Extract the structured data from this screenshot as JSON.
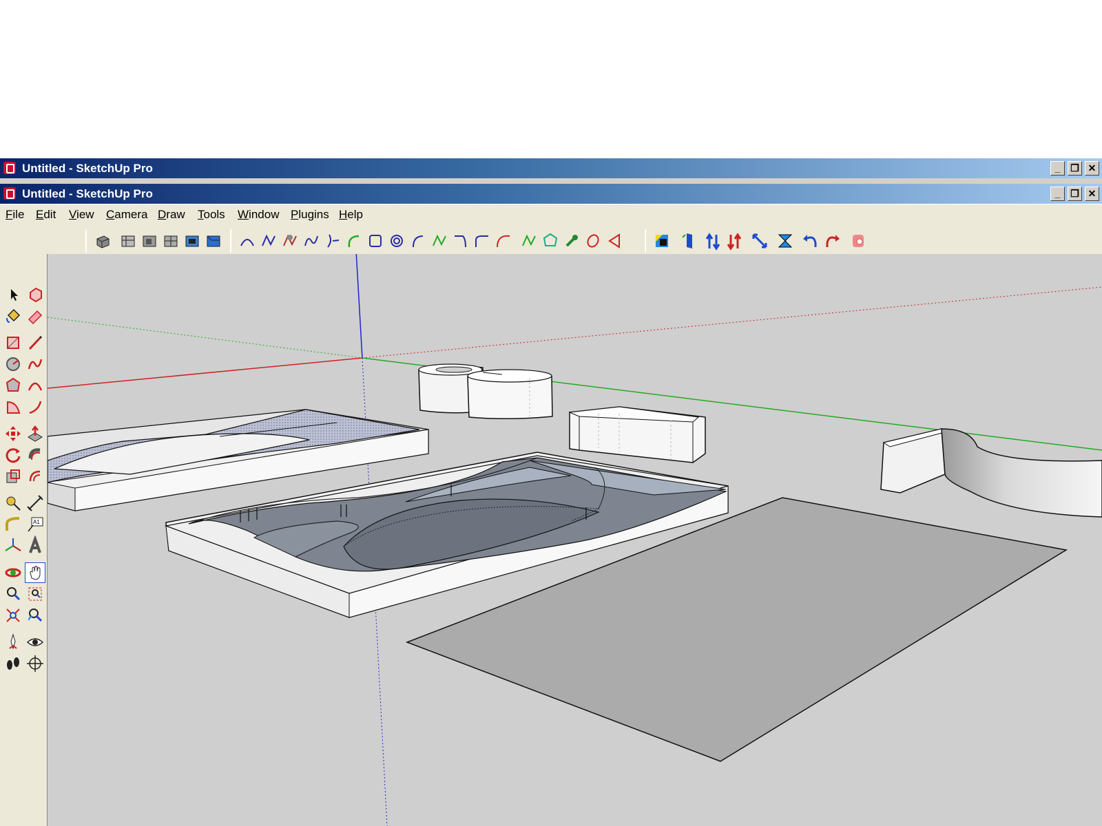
{
  "windows": [
    {
      "title": "Untitled - SketchUp Pro"
    },
    {
      "title": "Untitled - SketchUp Pro"
    }
  ],
  "window_controls": [
    "minimize",
    "restore",
    "close"
  ],
  "menu": [
    "File",
    "Edit",
    "View",
    "Camera",
    "Draw",
    "Tools",
    "Window",
    "Plugins",
    "Help"
  ],
  "toolbar_views": [
    "iso-view-icon",
    "top-view-icon",
    "front-view-icon",
    "right-view-icon",
    "back-view-icon",
    "left-view-icon"
  ],
  "toolbar_curves": [
    "bezier-icon",
    "polyline-icon",
    "freehand-icon",
    "spline-icon",
    "catmull-icon",
    "arc-icon",
    "rectangle-icon",
    "spiral-icon",
    "arc2-icon",
    "curve-icon",
    "corner-icon",
    "fillet-icon",
    "bezier2-icon",
    "zigzag-icon",
    "polygon-icon",
    "wrench-icon",
    "ellipse-icon",
    "triangle-icon"
  ],
  "toolbar_extra": [
    "face-tool-icon",
    "extrude-icon",
    "push-up-icon",
    "push-down-icon",
    "scale-icon",
    "hourglass-icon",
    "undo-arrow-icon",
    "redo-arrow-icon",
    "eraser-ghost-icon"
  ],
  "colors": {
    "title_start": "#0a246a",
    "title_end": "#a6caf0",
    "chrome": "#ece9d8",
    "viewport": "#cfcfcf",
    "axis_red": "#cc2222",
    "axis_green": "#22aa22",
    "axis_blue": "#2222cc"
  }
}
